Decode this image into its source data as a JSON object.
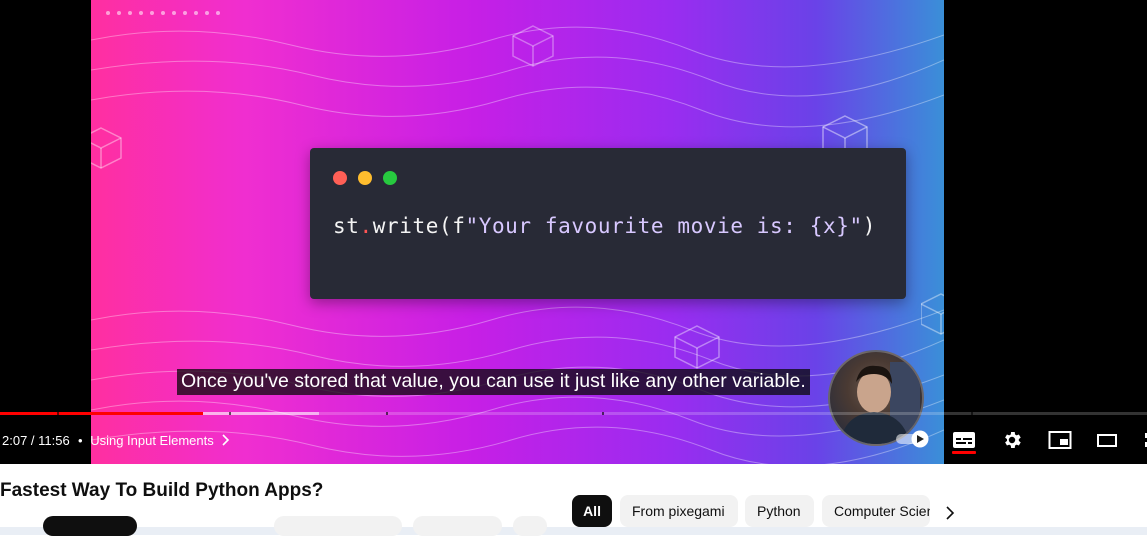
{
  "player": {
    "code": {
      "obj": "st",
      "dot": ".",
      "call": "write(f",
      "string": "\"Your favourite movie is: {x}\"",
      "close": ")"
    },
    "caption": "Once you've stored that value, you can use it just like any other variable.",
    "time": "2:07 / 11:56",
    "separator": "•",
    "chapter": "Using Input Elements",
    "progress_fraction": 0.177,
    "accent": "#ff0000"
  },
  "video": {
    "title": "Fastest Way To Build Python Apps?"
  },
  "chips": [
    {
      "label": "All",
      "active": true
    },
    {
      "label": "From pixegami",
      "active": false
    },
    {
      "label": "Python",
      "active": false
    },
    {
      "label": "Computer Science",
      "active": false
    }
  ],
  "icons": {
    "chevron_right": "chevron-right-icon",
    "autoplay": "autoplay-toggle-icon",
    "subtitles": "subtitles-icon",
    "settings": "gear-icon",
    "miniplayer": "miniplayer-icon",
    "theater": "theater-mode-icon",
    "fullscreen": "fullscreen-icon"
  }
}
